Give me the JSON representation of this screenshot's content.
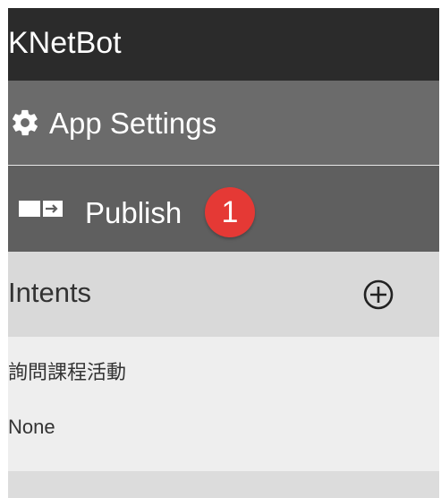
{
  "app": {
    "title": "KNetBot"
  },
  "nav": {
    "settings_label": "App Settings",
    "publish_label": "Publish",
    "publish_badge": "1"
  },
  "intents": {
    "title": "Intents",
    "items": [
      {
        "label": "詢問課程活動"
      },
      {
        "label": "None"
      }
    ]
  },
  "icons": {
    "settings": "gear-icon",
    "publish": "publish-arrow-icon",
    "add": "circle-plus-icon"
  },
  "colors": {
    "brand_bar": "#2b2b2b",
    "nav_bg": "#6b6b6b",
    "badge": "#e53935",
    "intents_header_bg": "#d9d9d9"
  }
}
